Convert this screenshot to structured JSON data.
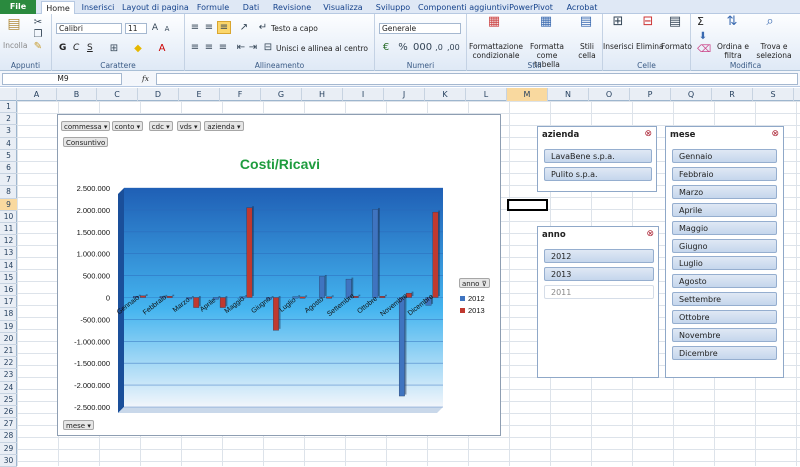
{
  "tabs": [
    {
      "label": "File"
    },
    {
      "label": "Home"
    },
    {
      "label": "Inserisci"
    },
    {
      "label": "Layout di pagina"
    },
    {
      "label": "Formule"
    },
    {
      "label": "Dati"
    },
    {
      "label": "Revisione"
    },
    {
      "label": "Visualizza"
    },
    {
      "label": "Sviluppo"
    },
    {
      "label": "Componenti aggiuntivi"
    },
    {
      "label": "PowerPivot"
    },
    {
      "label": "Acrobat"
    }
  ],
  "ribbon": {
    "groups": [
      "Appunti",
      "Carattere",
      "Allineamento",
      "Numeri",
      "Stili",
      "Celle",
      "Modifica"
    ],
    "paste_label": "Incolla",
    "font_name": "Calibri",
    "font_size": "11",
    "bold": "G",
    "italic": "C",
    "underline": "S",
    "wrap_text": "Testo a capo",
    "merge_center": "Unisci e allinea al centro",
    "number_format": "Generale",
    "cond_format": "Formattazione condizionale",
    "format_table": "Formatta come tabella",
    "cell_styles": "Stili cella",
    "insert": "Inserisci",
    "delete": "Elimina",
    "format": "Formato",
    "sort_filter": "Ordina e filtra",
    "find_select": "Trova e seleziona",
    "sigma": "Σ"
  },
  "formula_bar": {
    "name_box": "M9",
    "fx": "fx",
    "content": ""
  },
  "columns": [
    "A",
    "B",
    "C",
    "D",
    "E",
    "F",
    "G",
    "H",
    "I",
    "J",
    "K",
    "L",
    "M",
    "N",
    "O",
    "P",
    "Q",
    "R",
    "S"
  ],
  "rows": [
    "1",
    "2",
    "3",
    "4",
    "5",
    "6",
    "7",
    "8",
    "9",
    "10",
    "11",
    "12",
    "13",
    "14",
    "15",
    "16",
    "17",
    "18",
    "19",
    "20",
    "21",
    "22",
    "23",
    "24",
    "25",
    "26",
    "27",
    "28",
    "29",
    "30"
  ],
  "selected_cell": {
    "column": "M",
    "row": "9"
  },
  "chart": {
    "filters": [
      "commessa",
      "conto",
      "cdc",
      "vds",
      "azienda"
    ],
    "values_button": "Consuntivo",
    "axis_field_button": "mese",
    "legend_field_button": "anno"
  },
  "chart_data": {
    "type": "bar",
    "title": "Costi/Ricavi",
    "categories": [
      "Gennaio",
      "Febbraio",
      "Marzo",
      "Aprile",
      "Maggio",
      "Giugno",
      "Luglio",
      "Agosto",
      "Settembre",
      "Ottobre",
      "Novembre",
      "Dicembre"
    ],
    "series": [
      {
        "name": "2012",
        "color": "#3f74c0",
        "values": [
          30000,
          25000,
          -20000,
          -40000,
          20000,
          -40000,
          20000,
          480000,
          420000,
          2010000,
          -2250000,
          -180000
        ]
      },
      {
        "name": "2013",
        "color": "#c0392f",
        "values": [
          40000,
          30000,
          -230000,
          -230000,
          2050000,
          -750000,
          15000,
          15000,
          30000,
          30000,
          100000,
          1950000
        ]
      }
    ],
    "yticks": [
      "2.500.000",
      "2.000.000",
      "1.500.000",
      "1.000.000",
      "500.000",
      "0",
      "-500.000",
      "-1.000.000",
      "-1.500.000",
      "-2.000.000",
      "-2.500.000"
    ],
    "ylim": [
      -2500000,
      2500000
    ],
    "legend": "right"
  },
  "slicers": {
    "azienda": {
      "title": "azienda",
      "items": [
        {
          "label": "LavaBene s.p.a.",
          "selected": true
        },
        {
          "label": "Pulito  s.p.a.",
          "selected": true
        }
      ]
    },
    "anno": {
      "title": "anno",
      "items": [
        {
          "label": "2012",
          "selected": true
        },
        {
          "label": "2013",
          "selected": true
        },
        {
          "label": "2011",
          "selected": false
        }
      ]
    },
    "mese": {
      "title": "mese",
      "items": [
        {
          "label": "Gennaio"
        },
        {
          "label": "Febbraio"
        },
        {
          "label": "Marzo"
        },
        {
          "label": "Aprile"
        },
        {
          "label": "Maggio"
        },
        {
          "label": "Giugno"
        },
        {
          "label": "Luglio"
        },
        {
          "label": "Agosto"
        },
        {
          "label": "Settembre"
        },
        {
          "label": "Ottobre"
        },
        {
          "label": "Novembre"
        },
        {
          "label": "Dicembre"
        }
      ]
    }
  }
}
